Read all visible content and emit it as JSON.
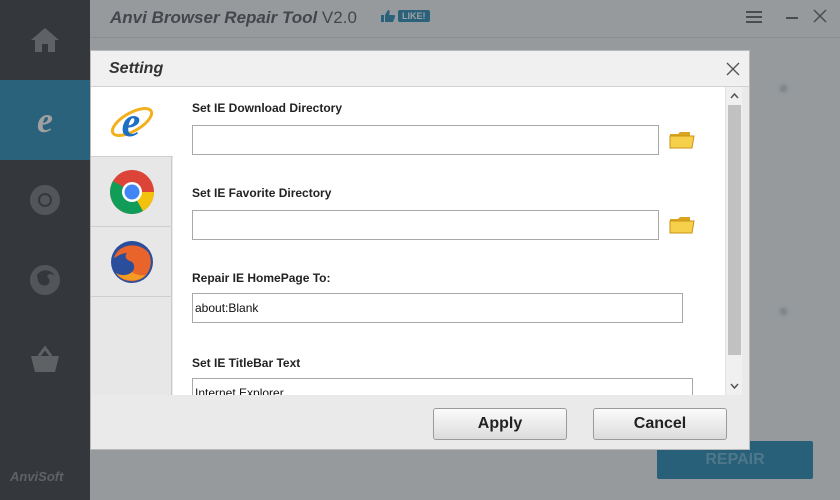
{
  "app": {
    "title": "Anvi Browser Repair Tool",
    "version": "V2.0",
    "like_label": "LIKE!",
    "brand": "AnviSoft",
    "repair_label": "REPAIR",
    "accent_color": "#2d8eb8"
  },
  "sidebar": {
    "items": [
      {
        "name": "home",
        "icon": "home-icon"
      },
      {
        "name": "ie",
        "icon": "ie-icon",
        "selected": true
      },
      {
        "name": "chrome",
        "icon": "chrome-icon"
      },
      {
        "name": "firefox",
        "icon": "firefox-icon"
      },
      {
        "name": "basket",
        "icon": "basket-icon"
      }
    ]
  },
  "dialog": {
    "title": "Setting",
    "tabs": [
      {
        "name": "ie",
        "icon": "ie-icon",
        "selected": true
      },
      {
        "name": "chrome",
        "icon": "chrome-icon"
      },
      {
        "name": "firefox",
        "icon": "firefox-icon"
      }
    ],
    "fields": {
      "download_dir": {
        "label": "Set IE Download Directory",
        "value": ""
      },
      "favorite_dir": {
        "label": "Set IE Favorite Directory",
        "value": ""
      },
      "homepage": {
        "label": "Repair IE HomePage To:",
        "value": "about:Blank"
      },
      "titlebar": {
        "label": "Set IE TitleBar Text",
        "value": "Internet Explorer"
      }
    },
    "apply_label": "Apply",
    "cancel_label": "Cancel"
  }
}
